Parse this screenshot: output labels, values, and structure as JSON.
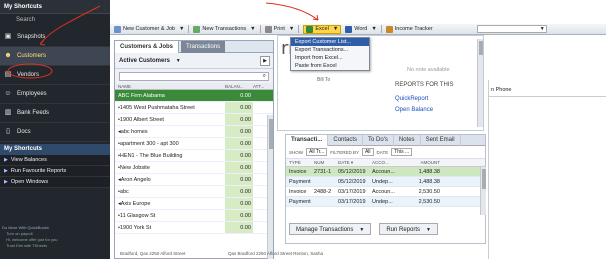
{
  "left_nav": {
    "header": "My Shortcuts",
    "search_label": "Search",
    "items": [
      {
        "label": "Snapshots",
        "icon": "camera-icon"
      },
      {
        "label": "Customers",
        "icon": "person-icon"
      },
      {
        "label": "Vendors",
        "icon": "truck-icon"
      },
      {
        "label": "Employees",
        "icon": "people-icon"
      },
      {
        "label": "Bank Feeds",
        "icon": "bank-icon"
      },
      {
        "label": "Docs",
        "icon": "document-icon"
      }
    ],
    "section_header": "My Shortcuts",
    "sub_items": [
      "View Balances",
      "Run Favourite Reports",
      "Open Windows"
    ],
    "do_more_title": "Do More With QuickBooks",
    "do_more_items": [
      "Turn on payroll",
      "Hi, welcome offer just for you",
      "Trust Elm with TSheets"
    ]
  },
  "toolbar": {
    "new_customer": "New Customer & Job",
    "new_transactions": "New Transactions",
    "print": "Print",
    "excel": "Excel",
    "word": "Word",
    "income_tracker": "Income Tracker"
  },
  "excel_menu": {
    "items": [
      "Export Customer List...",
      "Export Transactions...",
      "Import from Excel...",
      "Paste from Excel"
    ]
  },
  "customers": {
    "tab_customers": "Customers & Jobs",
    "tab_transactions": "Transactions",
    "filter": "Active Customers",
    "columns": [
      "NAME",
      "BALAN...",
      "ATT..."
    ],
    "rows": [
      {
        "name": "ABC Firm Alabama",
        "balance": "0.00"
      },
      {
        "name": "•1405 West Pushmataha Street",
        "balance": "0.00"
      },
      {
        "name": "•1900 Albert Street",
        "balance": "0.00"
      },
      {
        "name": "◂abc homes",
        "balance": "0.00"
      },
      {
        "name": "•apartment 300 - apt 300",
        "balance": "0.00"
      },
      {
        "name": "•HEN1 - The Blue Building",
        "balance": "0.00"
      },
      {
        "name": "•New Jobsite",
        "balance": "0.00"
      },
      {
        "name": "◂Aron Angelo",
        "balance": "0.00"
      },
      {
        "name": "•abc",
        "balance": "0.00"
      },
      {
        "name": "◂Axis Europe",
        "balance": "0.00"
      },
      {
        "name": "•11 Glasgow St",
        "balance": "0.00"
      },
      {
        "name": "•1900 York St",
        "balance": "0.00"
      }
    ]
  },
  "info": {
    "title": "rmation",
    "labels": [
      "Full Name",
      "Bill To"
    ],
    "note": "No note available",
    "reports_heading": "REPORTS FOR THIS",
    "links": [
      "QuickReport",
      "Open Balance"
    ],
    "phone_header": "n Phone"
  },
  "transactions": {
    "tabs": [
      "Transacti...",
      "Contacts",
      "To Do's",
      "Notes",
      "Sent Email"
    ],
    "filters": {
      "show_label": "SHOW",
      "show_value": "All Tr...",
      "filtered_label": "FILTERED BY",
      "filtered_value": "All",
      "date_label": "DATE",
      "date_value": "This ..."
    },
    "columns": [
      "TYPE",
      "NUM",
      "DATE ▾",
      "ACCO...",
      "AMOUNT"
    ],
    "rows": [
      {
        "type": "Invoice",
        "num": "2731-1",
        "date": "05/12/2019",
        "account": "Accoun...",
        "amount": "1,488.38"
      },
      {
        "type": "Payment",
        "num": "",
        "date": "05/12/2019",
        "account": "Undep...",
        "amount": "1,488.38"
      },
      {
        "type": "Invoice",
        "num": "2488-2",
        "date": "03/17/2019",
        "account": "Accoun...",
        "amount": "2,530.50"
      },
      {
        "type": "Payment",
        "num": "",
        "date": "03/17/2019",
        "account": "Undep...",
        "amount": "2,530.50"
      }
    ],
    "manage_btn": "Manage Transactions",
    "reports_btn": "Run Reports"
  },
  "bottom": {
    "left_text": "Bradford, Qas 2250 Alford Street",
    "right_text": "Qas Bradford 2250 Alford Street Renton, Sasha"
  },
  "colors": {
    "nav_bg": "#22272e",
    "selected_row": "#3a8a3a",
    "excel_highlight": "#ffd54a",
    "menu_highlight": "#2f5da8",
    "annotation_red": "#e03020"
  }
}
